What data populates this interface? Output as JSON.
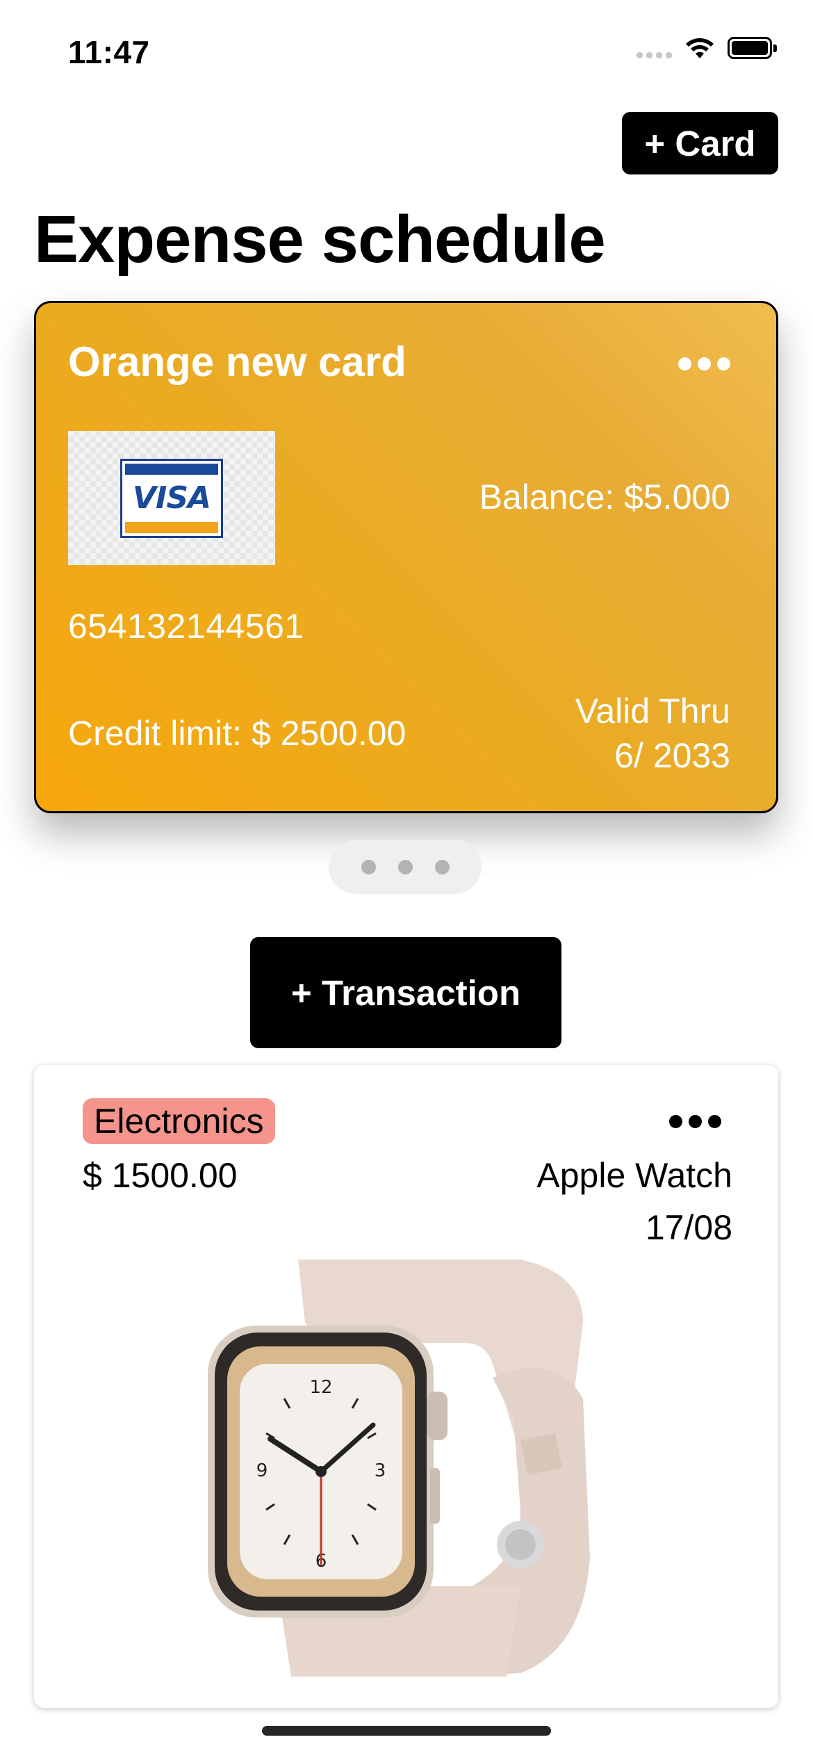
{
  "status_bar": {
    "time": "11:47"
  },
  "header": {
    "add_card_label": "+ Card",
    "title": "Expense schedule"
  },
  "card": {
    "name": "Orange new card",
    "brand_logo": "VISA",
    "balance": "Balance: $5.000",
    "number": "654132144561",
    "credit_limit": "Credit limit: $ 2500.00",
    "valid_thru_label": "Valid Thru",
    "valid_thru_date": "6/ 2033",
    "gradient_colors": [
      "#f7a70c",
      "#f1bd4f"
    ]
  },
  "pager": {
    "count": 3
  },
  "actions": {
    "add_transaction_label": "+ Transaction"
  },
  "transaction": {
    "category": "Electronics",
    "category_color": "#f4948a",
    "amount": "$ 1500.00",
    "name": "Apple Watch",
    "date": "17/08",
    "image_icon": "apple-watch-image"
  }
}
